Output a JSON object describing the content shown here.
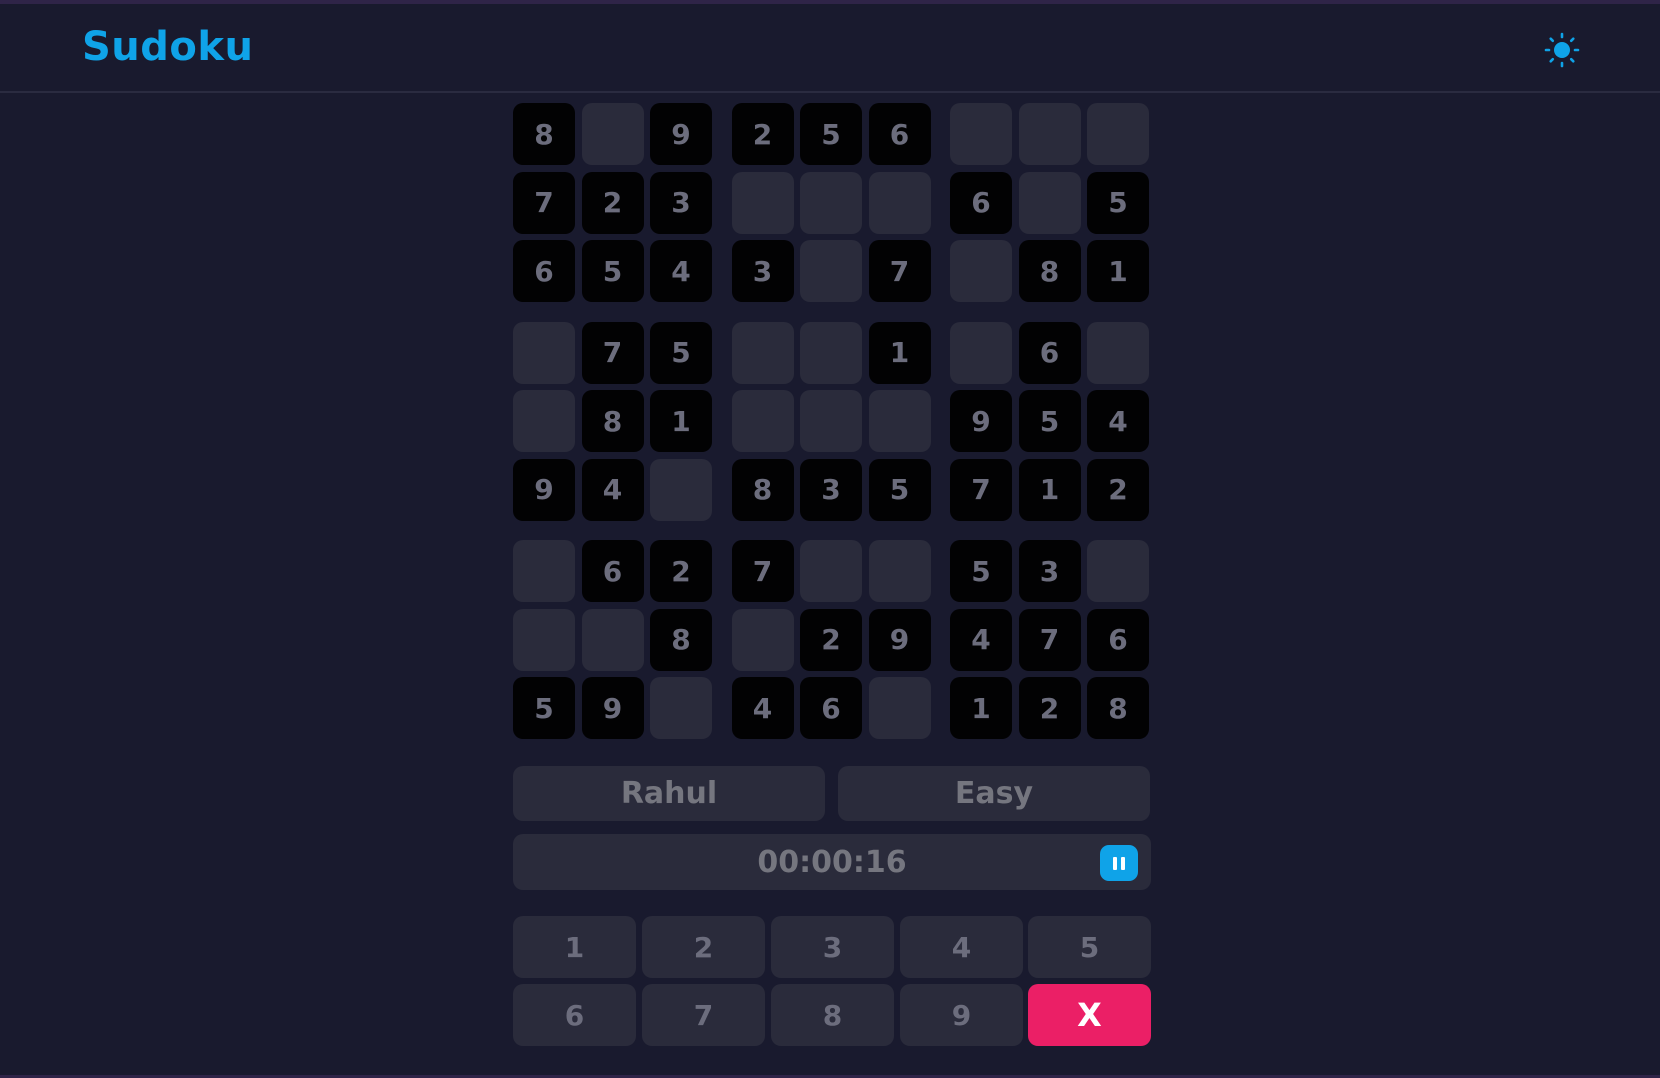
{
  "app": {
    "title": "Sudoku"
  },
  "colors": {
    "accent": "#0fa3e8",
    "erase": "#eb1f66",
    "background": "#191a2e",
    "given_cell": "#020203",
    "empty_cell": "#2a2b3b"
  },
  "header": {
    "theme_icon": "sun-icon"
  },
  "board": {
    "rows": [
      [
        "8",
        "",
        "9",
        "2",
        "5",
        "6",
        "",
        "",
        ""
      ],
      [
        "7",
        "2",
        "3",
        "",
        "",
        "",
        "6",
        "",
        "5"
      ],
      [
        "6",
        "5",
        "4",
        "3",
        "",
        "7",
        "",
        "8",
        "1"
      ],
      [
        "",
        "7",
        "5",
        "",
        "",
        "1",
        "",
        "6",
        ""
      ],
      [
        "",
        "8",
        "1",
        "",
        "",
        "",
        "9",
        "5",
        "4"
      ],
      [
        "9",
        "4",
        "",
        "8",
        "3",
        "5",
        "7",
        "1",
        "2"
      ],
      [
        "",
        "6",
        "2",
        "7",
        "",
        "",
        "5",
        "3",
        ""
      ],
      [
        "",
        "",
        "8",
        "",
        "2",
        "9",
        "4",
        "7",
        "6"
      ],
      [
        "5",
        "9",
        "",
        "4",
        "6",
        "",
        "1",
        "2",
        "8"
      ]
    ]
  },
  "info": {
    "player": "Rahul",
    "difficulty": "Easy"
  },
  "timer": {
    "time": "00:00:16",
    "pause_icon": "pause-icon"
  },
  "numpad": {
    "keys": [
      "1",
      "2",
      "3",
      "4",
      "5",
      "6",
      "7",
      "8",
      "9"
    ],
    "erase_label": "X"
  }
}
